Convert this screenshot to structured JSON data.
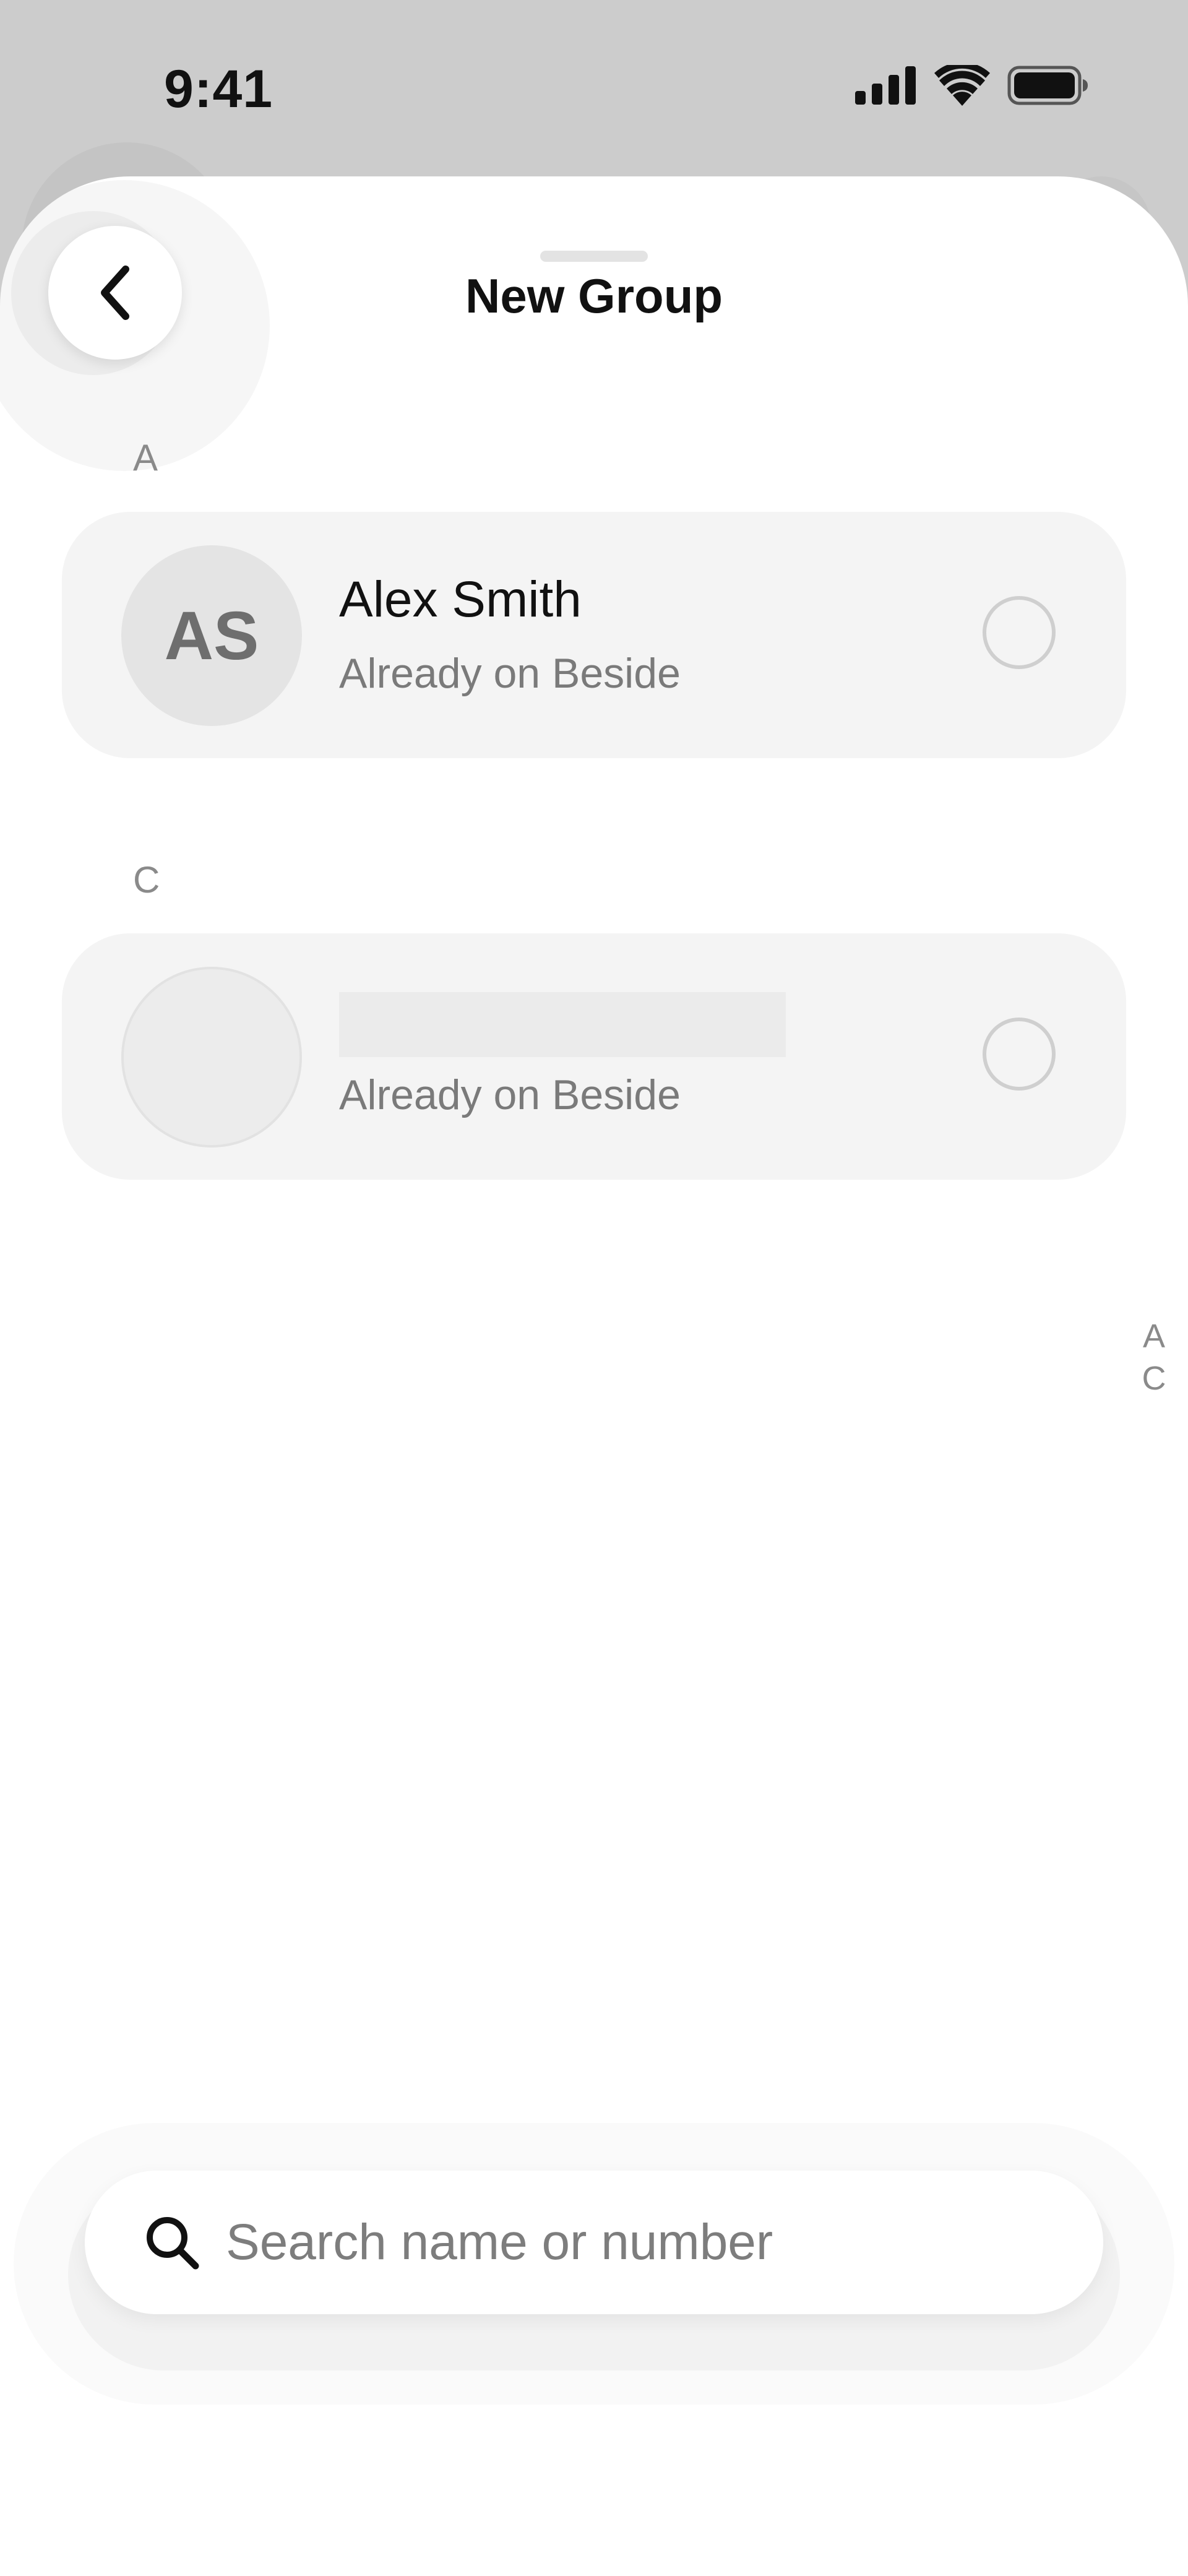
{
  "status_bar": {
    "time": "9:41",
    "signal_icon": "cellular-signal-icon",
    "wifi_icon": "wifi-icon",
    "battery_icon": "battery-icon"
  },
  "header": {
    "title": "New Group",
    "back_icon": "chevron-left-icon"
  },
  "sections": [
    {
      "letter": "A",
      "contacts": [
        {
          "initials": "AS",
          "name": "Alex Smith",
          "status": "Already on Beside",
          "selected": false
        }
      ]
    },
    {
      "letter": "C",
      "contacts": [
        {
          "initials": "",
          "name": "",
          "status": "Already on Beside",
          "selected": false
        }
      ]
    }
  ],
  "index": [
    "A",
    "C"
  ],
  "search": {
    "placeholder": "Search name or number",
    "value": "",
    "icon": "search-icon"
  },
  "colors": {
    "background": "#cccccc",
    "sheet": "#ffffff",
    "card": "#f4f4f4",
    "avatar": "#e4e4e4",
    "muted_text": "#7a7a7a"
  }
}
